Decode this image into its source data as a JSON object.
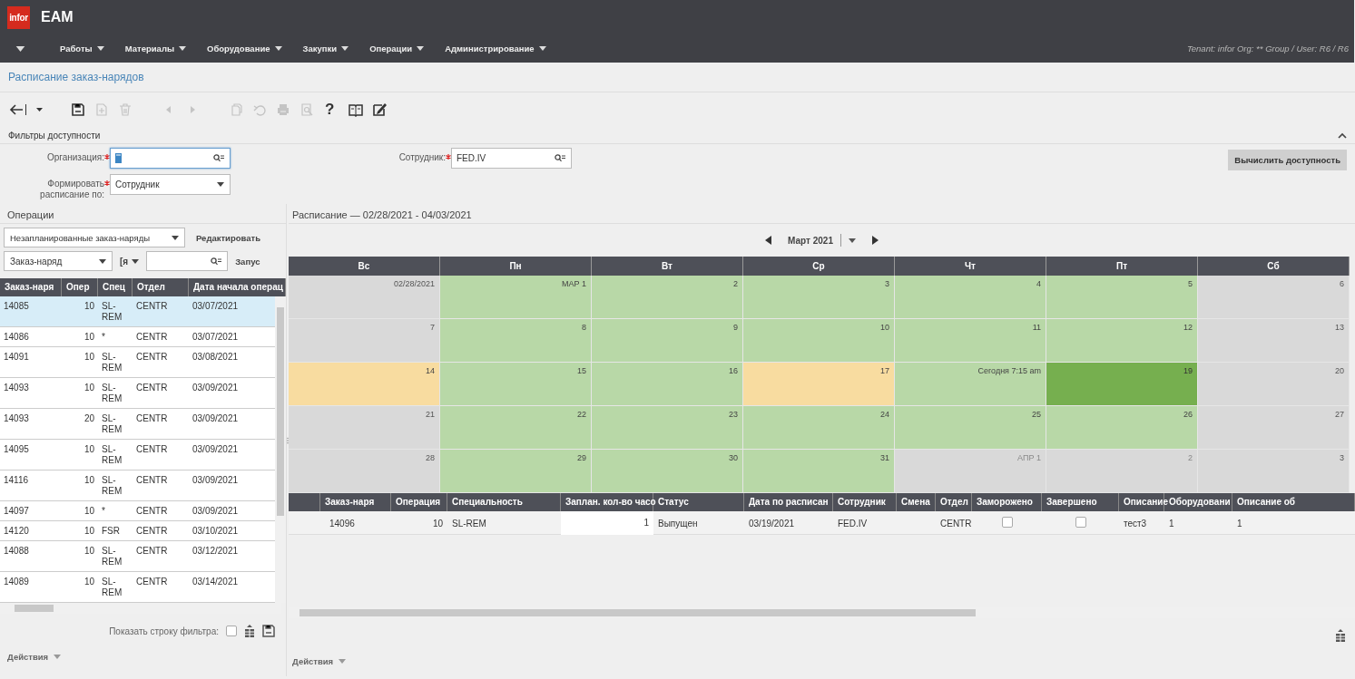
{
  "app": {
    "logo": "infor",
    "title": "EAM"
  },
  "menu": [
    {
      "label": "Работы"
    },
    {
      "label": "Материалы"
    },
    {
      "label": "Оборудование"
    },
    {
      "label": "Закупки"
    },
    {
      "label": "Операции"
    },
    {
      "label": "Администрирование"
    }
  ],
  "tenant": "Tenant: infor Org: ** Group / User: R6 / R6",
  "page_title": "Расписание заказ-нарядов",
  "toolbar": [
    {
      "kind": "back",
      "disabled": false
    },
    {
      "kind": "caret",
      "disabled": false
    },
    {
      "kind": "save",
      "disabled": false
    },
    {
      "kind": "new",
      "disabled": true
    },
    {
      "kind": "delete",
      "disabled": true
    },
    {
      "kind": "prev",
      "disabled": true
    },
    {
      "kind": "next",
      "disabled": true
    },
    {
      "kind": "copy",
      "disabled": true
    },
    {
      "kind": "undo",
      "disabled": true
    },
    {
      "kind": "print",
      "disabled": true
    },
    {
      "kind": "preview",
      "disabled": true
    },
    {
      "kind": "help",
      "label": "?",
      "disabled": false
    },
    {
      "kind": "book",
      "disabled": false
    },
    {
      "kind": "edit",
      "disabled": false
    }
  ],
  "filters": {
    "title": "Фильтры доступности",
    "expanded": true,
    "fields": [
      {
        "kind": "lookup",
        "label": "Организация:",
        "required": true,
        "focused": true
      },
      {
        "kind": "lookup",
        "label": "Сотрудник:",
        "required": true,
        "focused": false,
        "value": "FED.IV"
      },
      {
        "kind": "select",
        "label": "Формировать расписание по:",
        "required": true,
        "focused": false,
        "value": "Сотрудник"
      }
    ],
    "button": "Вычислить доступность"
  },
  "operations": {
    "title": "Операции",
    "view": "Незапланированные заказ-наряды",
    "edit": "Редактировать",
    "filter_field": "Заказ-наряд",
    "operator": "[я",
    "run": "Запус",
    "columns": [
      "Заказ-наря",
      "Опер",
      "Спец",
      "Отдел",
      "Дата начала операц"
    ],
    "rows": [
      {
        "selected": true,
        "cells": [
          "14085",
          "10",
          "SL-REM",
          "CENTR",
          "03/07/2021"
        ]
      },
      {
        "selected": false,
        "cells": [
          "14086",
          "10",
          "*",
          "CENTR",
          "03/07/2021"
        ]
      },
      {
        "selected": false,
        "cells": [
          "14091",
          "10",
          "SL-REM",
          "CENTR",
          "03/08/2021"
        ]
      },
      {
        "selected": false,
        "cells": [
          "14093",
          "10",
          "SL-REM",
          "CENTR",
          "03/09/2021"
        ]
      },
      {
        "selected": false,
        "cells": [
          "14093",
          "20",
          "SL-REM",
          "CENTR",
          "03/09/2021"
        ]
      },
      {
        "selected": false,
        "cells": [
          "14095",
          "10",
          "SL-REM",
          "CENTR",
          "03/09/2021"
        ]
      },
      {
        "selected": false,
        "cells": [
          "14116",
          "10",
          "SL-REM",
          "CENTR",
          "03/09/2021"
        ]
      },
      {
        "selected": false,
        "cells": [
          "14097",
          "10",
          "*",
          "CENTR",
          "03/09/2021"
        ]
      },
      {
        "selected": false,
        "cells": [
          "14120",
          "10",
          "FSR",
          "CENTR",
          "03/10/2021"
        ]
      },
      {
        "selected": false,
        "cells": [
          "14088",
          "10",
          "SL-REM",
          "CENTR",
          "03/12/2021"
        ]
      },
      {
        "selected": false,
        "cells": [
          "14089",
          "10",
          "SL-REM",
          "CENTR",
          "03/14/2021"
        ]
      }
    ],
    "filter_row_label": "Показать строку фильтра:",
    "filter_row_checked": false,
    "actions": "Действия"
  },
  "schedule": {
    "title": "Расписание — 02/28/2021 - 04/03/2021",
    "month": "Март 2021",
    "weekdays": [
      "Вс",
      "Пн",
      "Вт",
      "Ср",
      "Чт",
      "Пт",
      "Сб"
    ],
    "weeks": [
      [
        {
          "label": "02/28/2021",
          "kind": "off"
        },
        {
          "label": "МАР 1",
          "kind": "work"
        },
        {
          "label": "2",
          "kind": "work"
        },
        {
          "label": "3",
          "kind": "work"
        },
        {
          "label": "4",
          "kind": "work"
        },
        {
          "label": "5",
          "kind": "work"
        },
        {
          "label": "6",
          "kind": "off"
        }
      ],
      [
        {
          "label": "7",
          "kind": "off"
        },
        {
          "label": "8",
          "kind": "work"
        },
        {
          "label": "9",
          "kind": "work"
        },
        {
          "label": "10",
          "kind": "work"
        },
        {
          "label": "11",
          "kind": "work"
        },
        {
          "label": "12",
          "kind": "work"
        },
        {
          "label": "13",
          "kind": "off"
        }
      ],
      [
        {
          "label": "14",
          "kind": "partial"
        },
        {
          "label": "15",
          "kind": "work"
        },
        {
          "label": "16",
          "kind": "work"
        },
        {
          "label": "17",
          "kind": "partial"
        },
        {
          "label": "Сегодня 7:15 am",
          "kind": "work"
        },
        {
          "label": "19",
          "kind": "busy"
        },
        {
          "label": "20",
          "kind": "off"
        }
      ],
      [
        {
          "label": "21",
          "kind": "off"
        },
        {
          "label": "22",
          "kind": "work"
        },
        {
          "label": "23",
          "kind": "work"
        },
        {
          "label": "24",
          "kind": "work"
        },
        {
          "label": "25",
          "kind": "work"
        },
        {
          "label": "26",
          "kind": "work"
        },
        {
          "label": "27",
          "kind": "off"
        }
      ],
      [
        {
          "label": "28",
          "kind": "off"
        },
        {
          "label": "29",
          "kind": "work"
        },
        {
          "label": "30",
          "kind": "work"
        },
        {
          "label": "31",
          "kind": "work"
        },
        {
          "label": "АПР 1",
          "kind": "other"
        },
        {
          "label": "2",
          "kind": "other"
        },
        {
          "label": "3",
          "kind": "off"
        }
      ]
    ],
    "table": {
      "columns": [
        "Заказ-наря",
        "Операция",
        "Специальность",
        "Заплан. кол-во часо",
        "Статус",
        "Дата по расписан",
        "Сотрудник",
        "Смена",
        "Отдел",
        "Заморожено",
        "Завершено",
        "Описание",
        "Оборудовани",
        "Описание об"
      ],
      "rows": [
        {
          "order": "14096",
          "operation": "10",
          "trade": "SL-REM",
          "hours": "1",
          "status": "Выпущен",
          "date": "03/19/2021",
          "employee": "FED.IV",
          "dept": "CENTR",
          "frozen": false,
          "done": false,
          "description": "тест3",
          "equipment": "1",
          "equipment_description": "1"
        }
      ]
    },
    "actions": "Действия"
  }
}
